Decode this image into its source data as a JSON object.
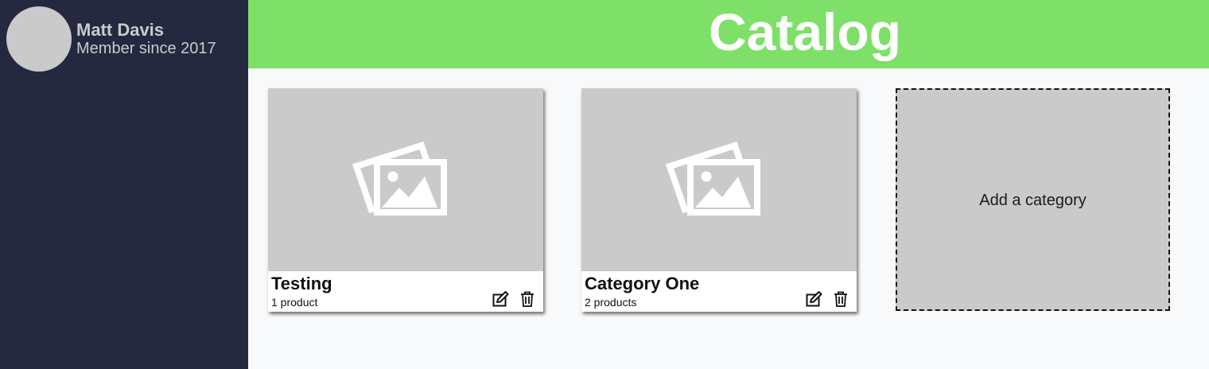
{
  "user": {
    "name": "Matt Davis",
    "member_since": "Member since 2017"
  },
  "header": {
    "title": "Catalog"
  },
  "categories": [
    {
      "title": "Testing",
      "count": "1 product",
      "image_icon": "photo-images-icon",
      "actions": [
        "edit-icon",
        "trash-icon"
      ]
    },
    {
      "title": "Category One",
      "count": "2 products",
      "image_icon": "photo-images-icon",
      "actions": [
        "edit-icon",
        "trash-icon"
      ]
    }
  ],
  "add_category": {
    "label": "Add a category"
  },
  "colors": {
    "sidebar": "#242940",
    "header": "#7ee068",
    "placeholder": "#cacaca",
    "page": "#f8f9fa"
  }
}
